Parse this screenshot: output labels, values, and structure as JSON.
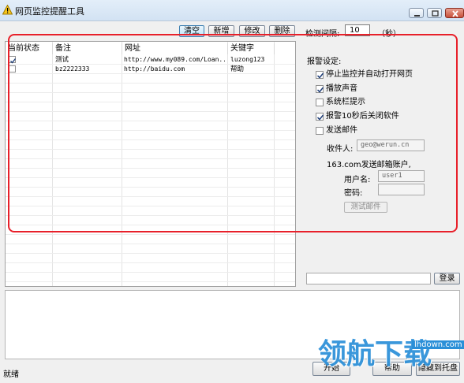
{
  "window": {
    "title": "网页监控提醒工具"
  },
  "toolbar": {
    "clear_label": "清空",
    "new_label": "新增",
    "edit_label": "修改",
    "delete_label": "删除",
    "interval_label": "检测间隔:",
    "interval_value": "10",
    "interval_unit": "（秒）"
  },
  "table": {
    "columns": [
      "当前状态",
      "备注",
      "网址",
      "关键字"
    ],
    "rows": [
      {
        "checked": true,
        "note": "测试",
        "url": "http://www.my089.com/Loan...",
        "keyword": "luzong123"
      },
      {
        "checked": false,
        "note": "bz2222333",
        "url": "http://baidu.com",
        "keyword": "帮助"
      }
    ]
  },
  "settings": {
    "heading": "报警设定:",
    "options": [
      {
        "label": "停止监控并自动打开网页",
        "checked": true
      },
      {
        "label": "播放声音",
        "checked": true
      },
      {
        "label": "系统栏提示",
        "checked": false
      },
      {
        "label": "报警10秒后关闭软件",
        "checked": true
      },
      {
        "label": "发送邮件",
        "checked": false
      }
    ],
    "recipient_label": "收件人:",
    "recipient_value": "geo@werun.cn",
    "account_heading": "163.com发送邮箱账户,",
    "username_label": "用户名:",
    "username_value": "user1",
    "password_label": "密码:",
    "password_value": "",
    "test_mail_label": "测试邮件"
  },
  "login": {
    "button_label": "登录",
    "input_value": ""
  },
  "status": {
    "text": "就绪"
  },
  "bottom_buttons": {
    "a_label": "开始",
    "b_label": "帮助",
    "c_label": "隐藏到托盘"
  },
  "watermark": {
    "text": "领航下载",
    "domain": "lhdown.com"
  },
  "colors": {
    "highlight": "#e8202a",
    "watermark": "#2a8fd8",
    "selected_button": "#bee6fd"
  }
}
